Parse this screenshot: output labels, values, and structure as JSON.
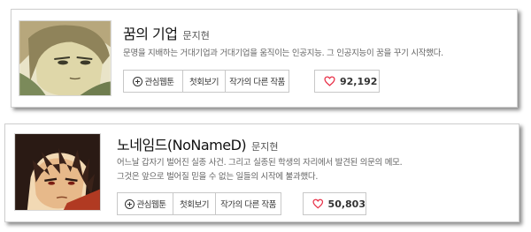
{
  "colors": {
    "heart": "#e8334a",
    "border": "#c8c8c8",
    "title": "#111111",
    "description": "#666666"
  },
  "items": [
    {
      "title": "꿈의 기업",
      "author": "문지현",
      "description_lines": [
        "문명을 지배하는 거대기업과 거대기업을 움직이는 인공지능. 그 인공지능이 꿈을 꾸기 시작했다."
      ],
      "buttons": {
        "favorite": "관심웹툰",
        "first_episode": "첫회보기",
        "other_works": "작가의 다른 작품"
      },
      "likes": "92,192",
      "icons": {
        "favorite": "plus-circle-icon",
        "likes": "heart-icon"
      }
    },
    {
      "title": "노네임드(NoNameD)",
      "author": "문지현",
      "description_lines": [
        "어느날 갑자기 벌어진 실종 사건. 그리고 실종된 학생의 자리에서 발견된 의문의 메모.",
        "그것은 앞으로 벌어질 믿을 수 없는 일들의 시작에 불과했다."
      ],
      "buttons": {
        "favorite": "관심웹툰",
        "first_episode": "첫회보기",
        "other_works": "작가의 다른 작품"
      },
      "likes": "50,803",
      "icons": {
        "favorite": "plus-circle-icon",
        "likes": "heart-icon"
      }
    }
  ]
}
